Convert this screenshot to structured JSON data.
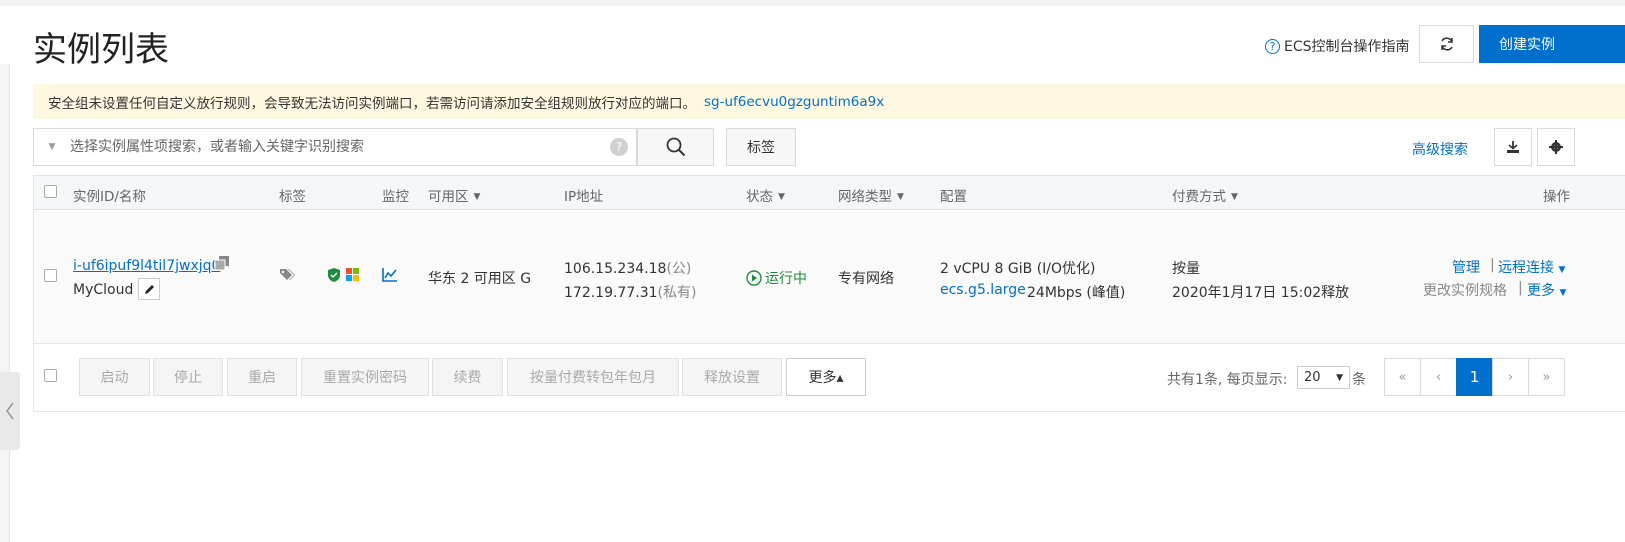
{
  "header": {
    "title": "实例列表",
    "guide_label": "ECS控制台操作指南",
    "create_label": "创建实例"
  },
  "warning": {
    "text": "安全组未设置任何自定义放行规则，会导致无法访问实例端口，若需访问请添加安全组规则放行对应的端口。",
    "link": "sg-uf6ecvu0gzguntim6a9x"
  },
  "search": {
    "placeholder": "选择实例属性项搜索，或者输入关键字识别搜索",
    "tag_label": "标签",
    "advanced_label": "高级搜索"
  },
  "table": {
    "columns": {
      "id_name": "实例ID/名称",
      "tags": "标签",
      "monitor": "监控",
      "zone": "可用区",
      "ip": "IP地址",
      "status": "状态",
      "network": "网络类型",
      "config": "配置",
      "billing": "付费方式",
      "actions": "操作"
    },
    "row": {
      "instance_id": "i-uf6ipuf9l4til7jwxjq0",
      "name": "MyCloud",
      "zone": "华东 2 可用区 G",
      "public_ip": "106.15.234.18",
      "public_tag": "(公)",
      "private_ip": "172.19.77.31",
      "private_tag": "(私有)",
      "status": "运行中",
      "network": "专有网络",
      "config_line1": "2 vCPU 8 GiB (I/O优化)",
      "instance_type": "ecs.g5.large",
      "bandwidth": "24Mbps (峰值)",
      "billing": "按量",
      "release_time": "2020年1月17日 15:02释放",
      "action_manage": "管理",
      "action_remote": "远程连接",
      "action_change_spec": "更改实例规格",
      "action_more": "更多"
    }
  },
  "footer": {
    "buttons": {
      "start": "启动",
      "stop": "停止",
      "restart": "重启",
      "reset_password": "重置实例密码",
      "renew": "续费",
      "convert": "按量付费转包年包月",
      "release": "释放设置",
      "more": "更多▴"
    },
    "total_text": "共有1条, 每页显示:",
    "page_size": "20",
    "page_unit": "条",
    "pager": {
      "first": "«",
      "prev": "‹",
      "current": "1",
      "next": "›",
      "last": "»"
    }
  },
  "colors": {
    "primary": "#0070cc",
    "warning_bg": "#fff8e1",
    "running": "#1e8e3e"
  }
}
